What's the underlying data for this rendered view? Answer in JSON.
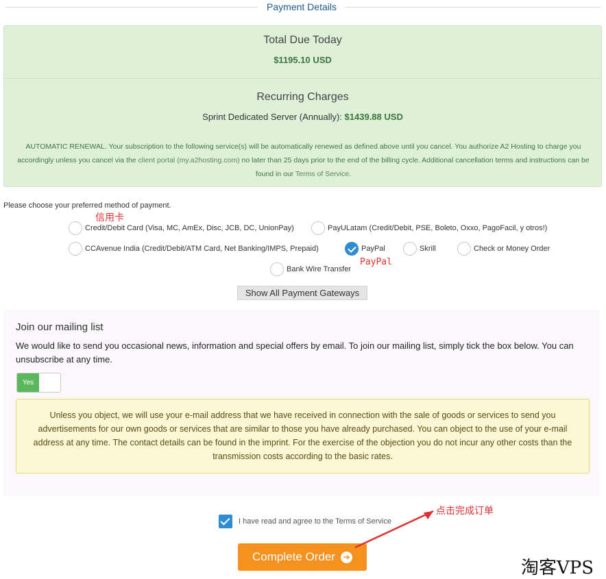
{
  "header": {
    "title": "Payment Details"
  },
  "summary": {
    "total_label": "Total Due Today",
    "total_amount": "$1195.10 USD",
    "recurring_label": "Recurring Charges",
    "recurring_item": "Sprint Dedicated Server (Annually):",
    "recurring_amount": "$1439.88 USD",
    "renewal_p1": "AUTOMATIC RENEWAL. Your subscription to the following service(s) will be automatically renewed as defined above until you cancel. You authorize A2 Hosting to charge you accordingly unless you cancel via the ",
    "renewal_link1": "client portal (my.a2hosting.com)",
    "renewal_p2": " no later than 25 days prior to the end of the billing cycle. Additional cancellation terms and instructions can be found in our ",
    "renewal_link2": "Terms of Service",
    "renewal_p3": "."
  },
  "payment": {
    "prompt": "Please choose your preferred method of payment.",
    "methods": [
      {
        "label": "Credit/Debit Card (Visa, MC, AmEx, Disc, JCB, DC, UnionPay)",
        "selected": false
      },
      {
        "label": "PayULatam (Credit/Debit, PSE, Boleto, Oxxo, PagoFacil, y otros!)",
        "selected": false
      },
      {
        "label": "CCAvenue India (Credit/Debit/ATM Card, Net Banking/IMPS, Prepaid)",
        "selected": false
      },
      {
        "label": "PayPal",
        "selected": true
      },
      {
        "label": "Skrill",
        "selected": false
      },
      {
        "label": "Check or Money Order",
        "selected": false
      },
      {
        "label": "Bank Wire Transfer",
        "selected": false
      }
    ],
    "show_all_label": "Show All Payment Gateways"
  },
  "mailing": {
    "title": "Join our mailing list",
    "description": "We would like to send you occasional news, information and special offers by email. To join our mailing list, simply tick the box below. You can unsubscribe at any time.",
    "toggle_label": "Yes",
    "notice": "Unless you object, we will use your e-mail address that we have received in connection with the sale of goods or services to send you advertisements for our own goods or services that are similar to those you have already purchased. You can object to the use of your e-mail address at any time. The contact details can be found in the imprint. For the exercise of the objection you do not incur any other costs than the transmission costs according to the basic rates."
  },
  "footer": {
    "tos_label": "I have read and agree to the Terms of Service",
    "complete_label": "Complete Order",
    "complete_icon": "arrow-circle-right-icon"
  },
  "annotations": {
    "credit_card_note": "信用卡",
    "paypal_note": "PayPal",
    "complete_note": "点击完成订单",
    "watermark": "淘客VPS"
  },
  "colors": {
    "accent_blue": "#2e8ccf",
    "success_green": "#3c763d",
    "summary_bg": "#dff0d8",
    "order_orange": "#f5911e",
    "annotation_red": "#e03030"
  }
}
